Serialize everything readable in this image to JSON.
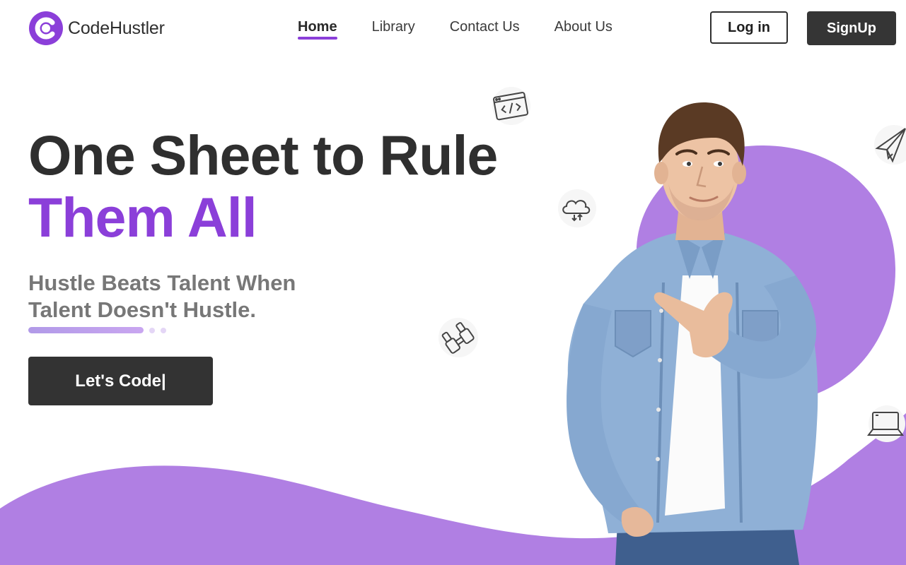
{
  "brand": {
    "name": "CodeHustler",
    "accent": "#8b3fd9",
    "dark": "#333333"
  },
  "nav": {
    "items": [
      {
        "label": "Home",
        "active": true
      },
      {
        "label": "Library",
        "active": false
      },
      {
        "label": "Contact Us",
        "active": false
      },
      {
        "label": "About Us",
        "active": false
      }
    ],
    "login_label": "Log in",
    "signup_label": "SignUp"
  },
  "hero": {
    "title_line1": "One Sheet to Rule",
    "title_line2": "Them All",
    "subtitle_line1": "Hustle Beats Talent When",
    "subtitle_line2": "Talent Doesn't Hustle.",
    "cta_label": "Let's Code|"
  },
  "decor": {
    "icons": [
      "code-window-icon",
      "cloud-sync-icon",
      "paper-plane-icon",
      "binoculars-icon",
      "laptop-icon"
    ],
    "blob_color": "#b07fe3"
  }
}
